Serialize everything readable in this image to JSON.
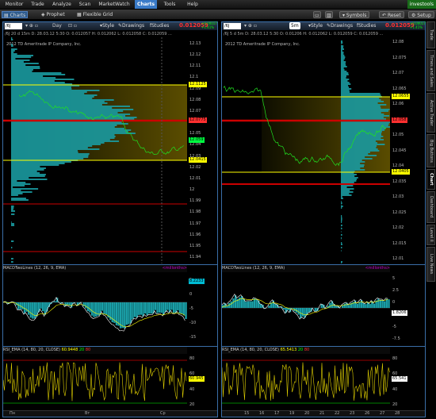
{
  "menu": [
    {
      "label": "Monitor"
    },
    {
      "label": "Trade"
    },
    {
      "label": "Analyze"
    },
    {
      "label": "Scan"
    },
    {
      "label": "MarketWatch"
    },
    {
      "label": "Charts",
      "active": true
    },
    {
      "label": "Tools"
    },
    {
      "label": "Help"
    }
  ],
  "brand": "investools",
  "toolbar": {
    "tab_charts": "Charts",
    "tab_prophet": "Prophet",
    "tab_flexible": "Flexible Grid",
    "symbols": "Symbols",
    "reset": "Reset",
    "setup": "Setup"
  },
  "left": {
    "symbol": "/6J",
    "interval": "Day",
    "price": "0.012059",
    "change_top": "+0.00017",
    "change_bot": "+1.41%",
    "style": "Style",
    "drawings": "Drawings",
    "studies": "Studies",
    "info": "/6J 20 d 15m  D: 28.03.12 5:30  O: 0.012057  H: 0.012062  L: 0.012058  C: 0.012059  ...",
    "copyright": "2012 TD Ameritrade IP Company, Inc.",
    "price_ticks": [
      "12.13",
      "12.12",
      "12.11",
      "12.1",
      "12.09",
      "12.08",
      "12.07",
      "12.06",
      "12.05",
      "12.04",
      "12.03",
      "12.02",
      "12.01",
      "12",
      "11.99",
      "11.98",
      "11.97",
      "11.96",
      "11.95",
      "11.94"
    ],
    "price_labels": [
      {
        "text": "12.1125",
        "color": "#ffff00"
      },
      {
        "text": "12.0775",
        "color": "#ff3030"
      },
      {
        "text": "12.059",
        "color": "#00ff40"
      },
      {
        "text": "12.0415",
        "color": "#ffff00"
      }
    ],
    "macd_head": "MACDTwoLines (12, 26, 9, EMA)",
    "macd_unit": "<millonths>",
    "macd_value": "8.2233",
    "macd_ticks": [
      "5",
      "0",
      "-5",
      "-10",
      "-15"
    ],
    "rsi_head": "RSI_EMA (14, 80, 20, CLOSE)",
    "rsi_val": "60.9448",
    "rsi_80": "80",
    "rsi_20": "20",
    "rsi_value": "60.945",
    "rsi_ticks": [
      "80",
      "60",
      "40",
      "20"
    ],
    "x_labels": [
      "Пн",
      "Вт",
      "Ср"
    ]
  },
  "right": {
    "symbol": "/6J",
    "interval": "5m",
    "price": "0.012059",
    "change_top": "+0.00017",
    "change_bot": "+1.41%",
    "style": "Style",
    "drawings": "Drawings",
    "studies": "Studies",
    "info": "/6J 5 d 5m  D: 28.03.12 5:30  O: 0.01206  H: 0.012062  L: 0.012059  C: 0.012059  ...",
    "copyright": "2012 TD Ameritrade IP Company, Inc.",
    "price_ticks": [
      "12.08",
      "12.075",
      "12.07",
      "12.065",
      "12.06",
      "12.055",
      "12.05",
      "12.045",
      "12.04",
      "12.035",
      "12.03",
      "12.025",
      "12.02",
      "12.015",
      "12.01"
    ],
    "price_labels": [
      {
        "text": "12.0655",
        "color": "#ffff00"
      },
      {
        "text": "12.058",
        "color": "#ff3030"
      },
      {
        "text": "12.0405",
        "color": "#ffff00"
      }
    ],
    "macd_head": "MACDTwoLines (12, 26, 9, EMA)",
    "macd_unit": "<millonths>",
    "macd_value": "1.8206",
    "macd_ticks": [
      "5",
      "2.5",
      "0",
      "-2.5",
      "-5",
      "-7.5"
    ],
    "rsi_head": "RSI_EMA (14, 80, 20, CLOSE)",
    "rsi_val": "65.5413",
    "rsi_80": "80",
    "rsi_20": "20",
    "rsi_value": "65.541",
    "rsi_ticks": [
      "80",
      "60",
      "40",
      "20"
    ],
    "x_labels": [
      "15",
      "16",
      "17",
      "19",
      "20",
      "21",
      "22",
      "23",
      "26",
      "27",
      "28"
    ]
  },
  "side_tabs": [
    {
      "label": "Trade"
    },
    {
      "label": "Times and Sales"
    },
    {
      "label": "Active Trader"
    },
    {
      "label": "Big Buttons"
    },
    {
      "label": "Chart",
      "active": true
    },
    {
      "label": "Dashboard"
    },
    {
      "label": "Level II"
    },
    {
      "label": "Live News"
    }
  ]
}
